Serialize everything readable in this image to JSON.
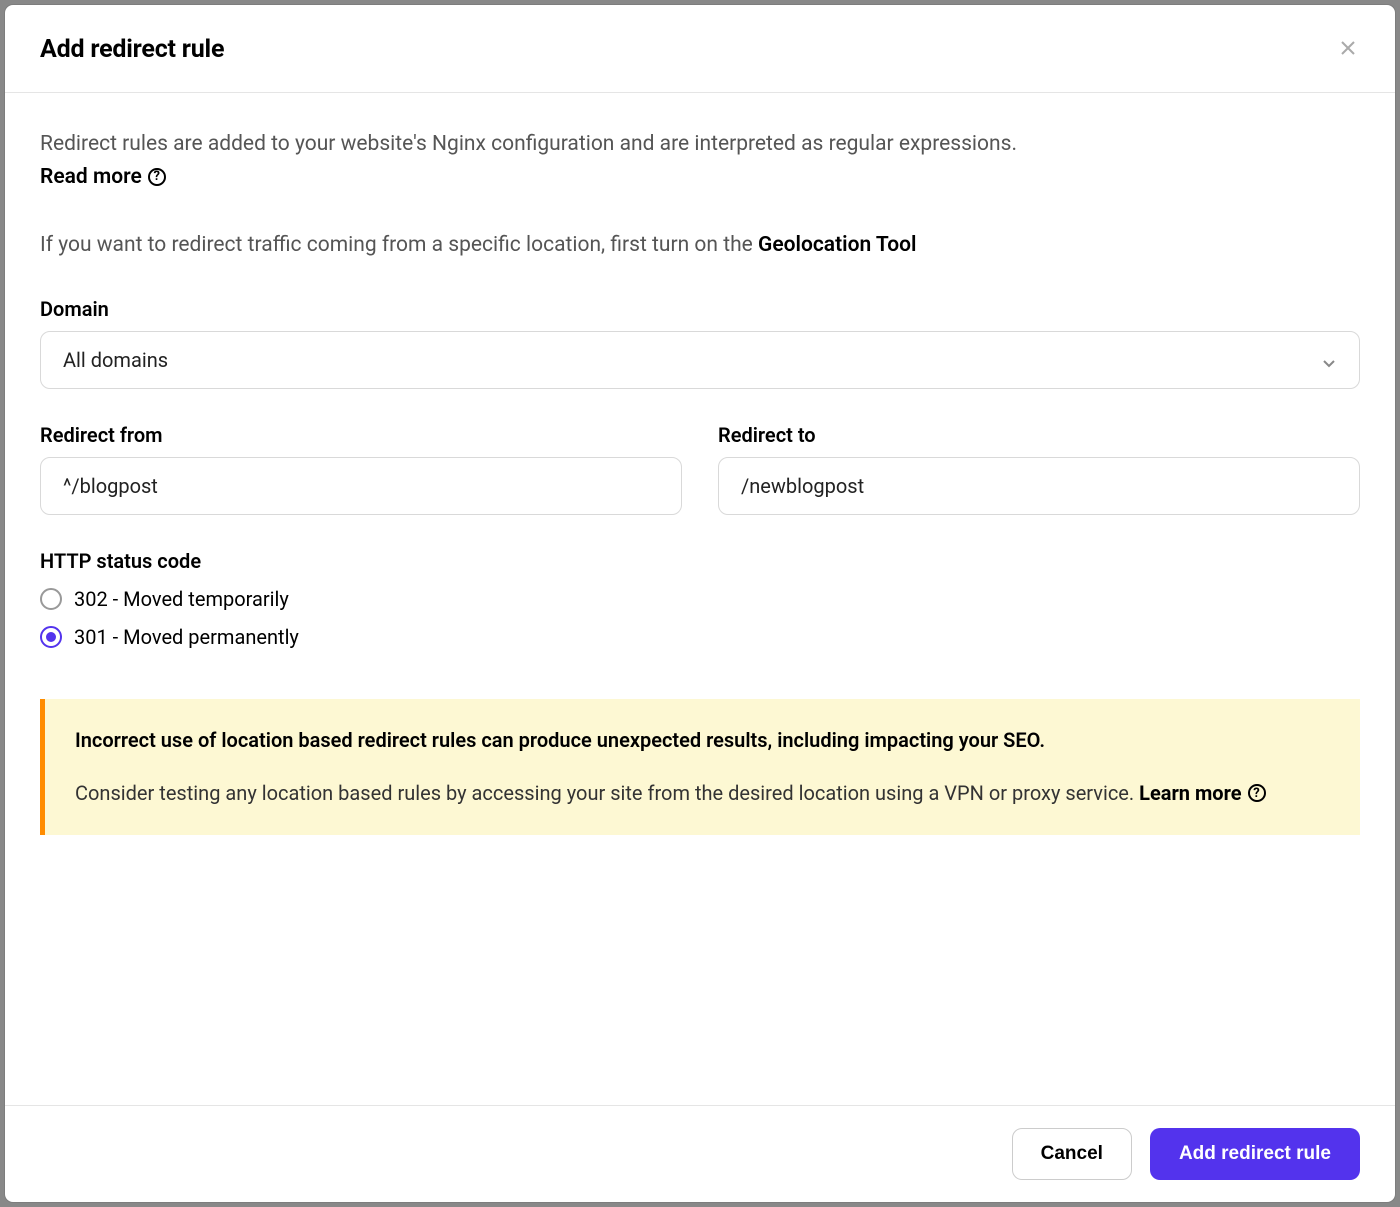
{
  "header": {
    "title": "Add redirect rule"
  },
  "intro": {
    "description": "Redirect rules are added to your website's Nginx configuration and are interpreted as regular expressions.",
    "read_more": "Read more"
  },
  "geo": {
    "prefix": "If you want to redirect traffic coming from a specific location, first turn on the ",
    "bold": "Geolocation Tool"
  },
  "domain": {
    "label": "Domain",
    "selected": "All domains"
  },
  "redirect_from": {
    "label": "Redirect from",
    "value": "^/blogpost"
  },
  "redirect_to": {
    "label": "Redirect to",
    "value": "/newblogpost"
  },
  "status": {
    "label": "HTTP status code",
    "options": [
      {
        "label": "302 - Moved temporarily",
        "checked": false
      },
      {
        "label": "301 - Moved permanently",
        "checked": true
      }
    ]
  },
  "warning": {
    "line1": "Incorrect use of location based redirect rules can produce unexpected results, including impacting your SEO.",
    "line2_prefix": "Consider testing any location based rules by accessing your site from the desired location using a VPN or proxy service. ",
    "learn_more": "Learn more"
  },
  "footer": {
    "cancel": "Cancel",
    "submit": "Add redirect rule"
  }
}
